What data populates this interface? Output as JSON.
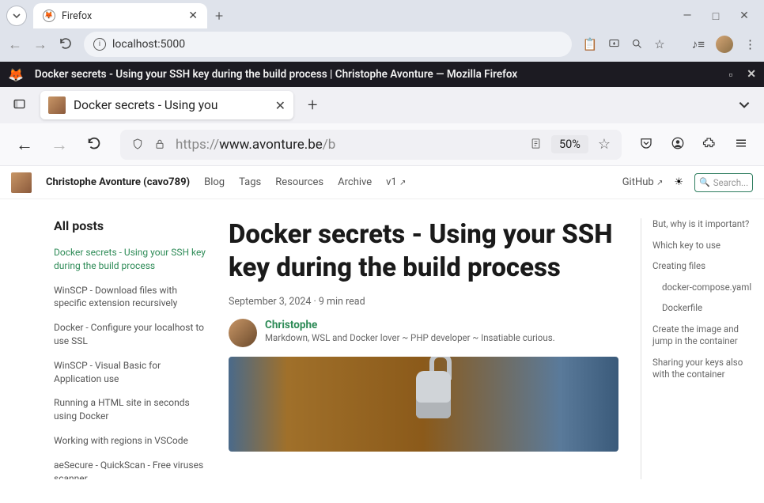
{
  "outer": {
    "tab_title": "Firefox",
    "address": "localhost:5000",
    "new_tab": "+",
    "win": {
      "min": "—",
      "max": "□",
      "close": "✕"
    }
  },
  "inner": {
    "title": "Docker secrets - Using your SSH key during the build process | Christophe Avonture — Mozilla Firefox",
    "tab_title": "Docker secrets - Using you",
    "address_prefix": "https://",
    "address_domain": "www.avonture.be",
    "address_path": "/b",
    "zoom": "50%",
    "new_tab": "+"
  },
  "site": {
    "brand": "Christophe Avonture (cavo789)",
    "nav": [
      "Blog",
      "Tags",
      "Resources",
      "Archive",
      "v1"
    ],
    "github": "GitHub",
    "search_placeholder": "Search..."
  },
  "sidebar": {
    "heading": "All posts",
    "posts": [
      "Docker secrets - Using your SSH key during the build process",
      "WinSCP - Download files with specific extension recursively",
      "Docker - Configure your localhost to use SSL",
      "WinSCP - Visual Basic for Application use",
      "Running a HTML site in seconds using Docker",
      "Working with regions in VSCode",
      "aeSecure - QuickScan - Free viruses scanner"
    ]
  },
  "article": {
    "title": "Docker secrets - Using your SSH key during the build process",
    "date": "September 3, 2024",
    "read": "9 min read",
    "sep": " · ",
    "author_name": "Christophe",
    "author_desc": "Markdown, WSL and Docker lover ~ PHP developer ~ Insatiable curious."
  },
  "toc": [
    {
      "label": "But, why is it important?",
      "sub": false
    },
    {
      "label": "Which key to use",
      "sub": false
    },
    {
      "label": "Creating files",
      "sub": false
    },
    {
      "label": "docker-compose.yaml",
      "sub": true
    },
    {
      "label": "Dockerfile",
      "sub": true
    },
    {
      "label": "Create the image and jump in the container",
      "sub": false
    },
    {
      "label": "Sharing your keys also with the container",
      "sub": false
    }
  ]
}
